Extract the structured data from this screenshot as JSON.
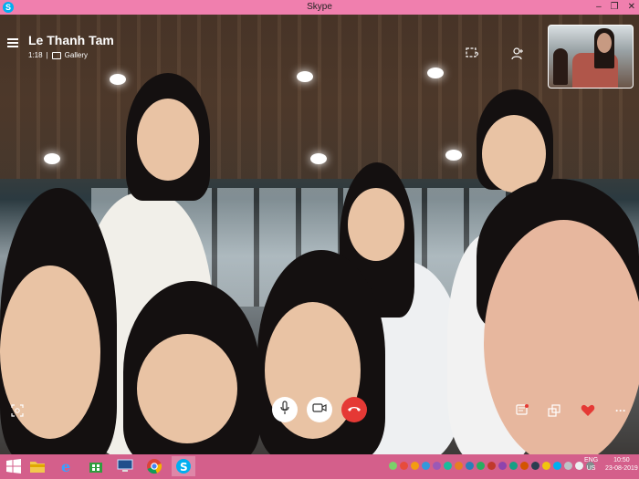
{
  "window": {
    "title": "Skype",
    "app_icon_glyph": "S",
    "minimize_glyph": "–",
    "restore_glyph": "❐",
    "close_glyph": "✕"
  },
  "call": {
    "caller_name": "Le Thanh Tam",
    "duration": "1:18",
    "separator": "|",
    "view_mode": "Gallery"
  },
  "top_icons": [
    "screen-share-icon",
    "add-person-icon"
  ],
  "controls": {
    "left": "snapshot-icon",
    "center": [
      "microphone-icon",
      "camera-icon",
      "hang-up-icon"
    ],
    "right": [
      "chat-icon",
      "switch-view-icon",
      "heart-icon",
      "more-icon"
    ],
    "more_glyph": "···"
  },
  "taskbar": {
    "apps": [
      "windows-start-icon",
      "file-explorer-icon",
      "internet-explorer-icon",
      "store-icon",
      "computer-icon",
      "chrome-icon",
      "skype-icon"
    ],
    "language_top": "ENG",
    "language_bottom": "US",
    "time": "10:50",
    "date": "23-08-2019"
  },
  "colors": {
    "titlebar": "#f07fae",
    "taskbar": "#d45f8b",
    "hangup": "#e53935",
    "skype": "#00aff0"
  }
}
